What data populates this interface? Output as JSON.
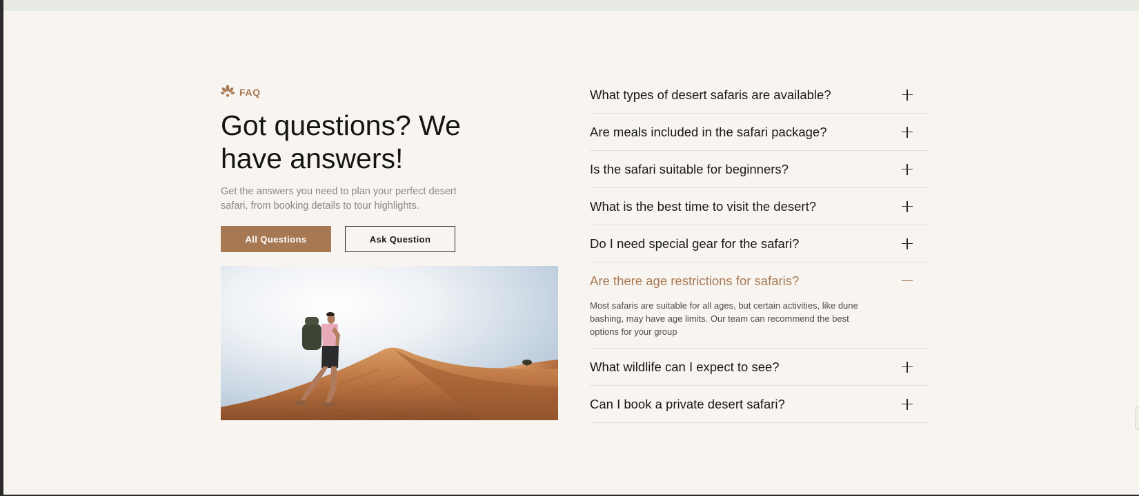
{
  "eyebrow": {
    "icon": "lotus-icon",
    "label": "FAQ"
  },
  "heading": "Got questions? We have answers!",
  "description": "Get the answers you need to plan your perfect desert safari, from booking details to tour highlights.",
  "buttons": {
    "primary": "All Questions",
    "secondary": "Ask Question"
  },
  "image": {
    "subject": "hiker-on-sand-dune"
  },
  "colors": {
    "accent": "#a87853",
    "background": "#f8f5f1",
    "text": "#181818"
  },
  "faq": [
    {
      "question": "What types of desert safaris are available?",
      "open": false
    },
    {
      "question": "Are meals included in the safari package?",
      "open": false
    },
    {
      "question": "Is the safari suitable for beginners?",
      "open": false
    },
    {
      "question": "What is the best time to visit the desert?",
      "open": false
    },
    {
      "question": "Do I need special gear for the safari?",
      "open": false
    },
    {
      "question": "Are there age restrictions for safaris?",
      "open": true,
      "answer": "Most safaris are suitable for all ages, but certain activities, like dune bashing, may have age limits. Our team can recommend the best options for your group"
    },
    {
      "question": "What wildlife can I expect to see?",
      "open": false
    },
    {
      "question": "Can I book a private desert safari?",
      "open": false
    }
  ]
}
